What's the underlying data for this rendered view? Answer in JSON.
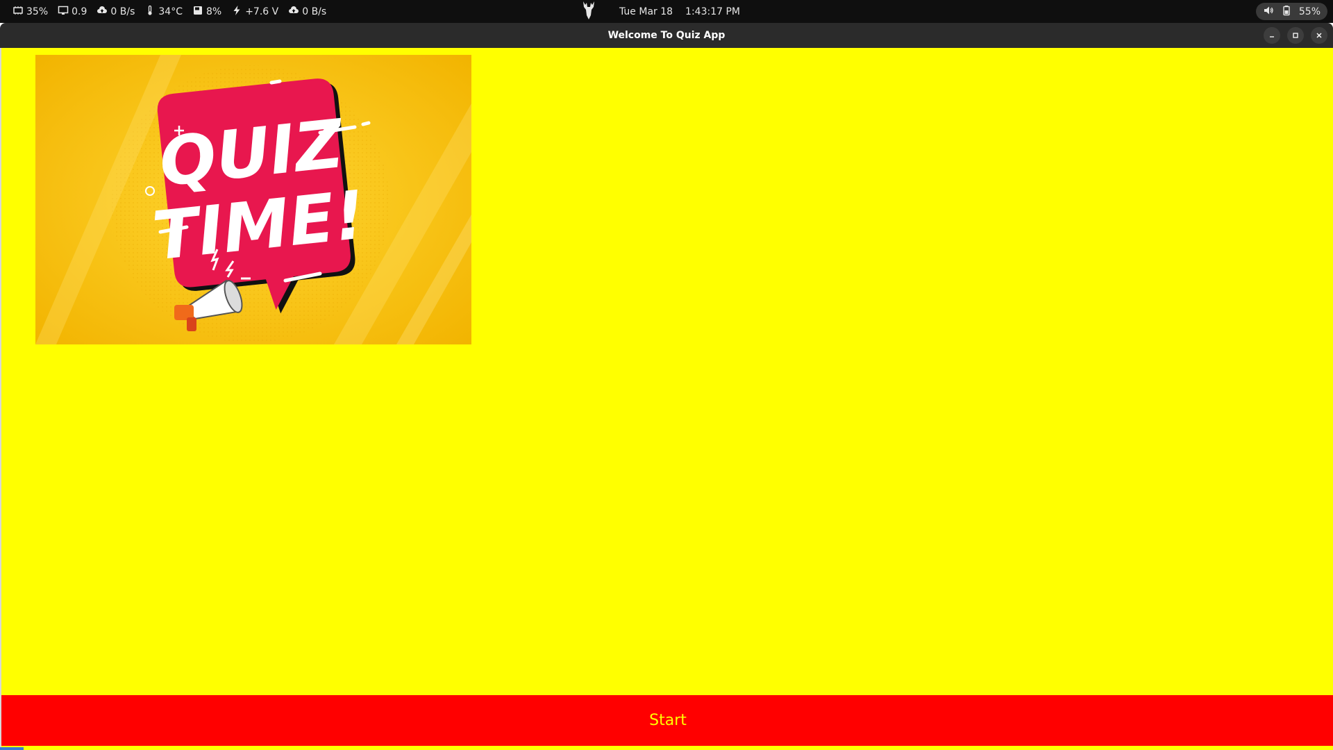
{
  "system_bar": {
    "indicators": [
      {
        "icon": "cpu-icon",
        "value": "35%"
      },
      {
        "icon": "monitor-icon",
        "value": "0.9"
      },
      {
        "icon": "upload-icon",
        "value": "0 B/s"
      },
      {
        "icon": "thermometer-icon",
        "value": "34°C"
      },
      {
        "icon": "disk-icon",
        "value": "8%"
      },
      {
        "icon": "bolt-icon",
        "value": "+7.6 V"
      },
      {
        "icon": "download-icon",
        "value": "0 B/s"
      }
    ],
    "date": "Tue Mar 18",
    "time": "1:43:17 PM",
    "battery": "55%"
  },
  "window": {
    "title": "Welcome To Quiz App"
  },
  "hero": {
    "line1": "QUIZ",
    "line2": "TIME!"
  },
  "actions": {
    "start_label": "Start"
  },
  "colors": {
    "background": "#ffff00",
    "button_bg": "#ff0000",
    "button_text": "#ffff00",
    "bubble": "#e8174e"
  }
}
